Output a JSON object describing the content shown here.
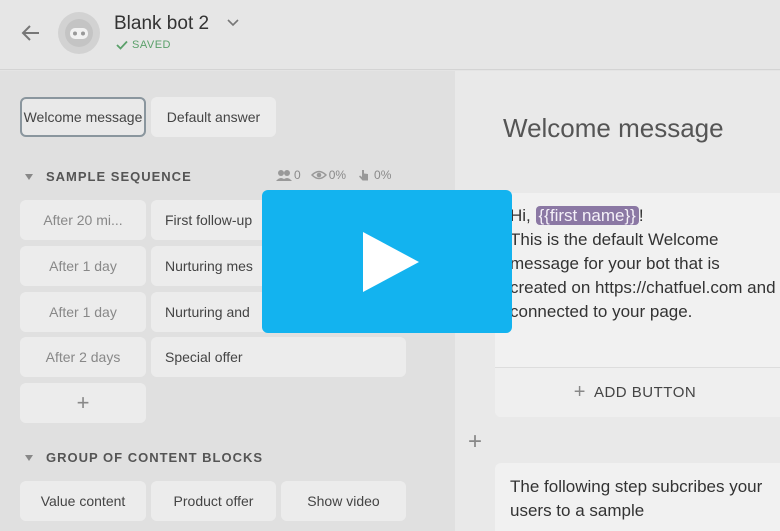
{
  "header": {
    "bot_name": "Blank bot 2",
    "saved_label": "SAVED"
  },
  "left": {
    "top_chips": [
      "Welcome message",
      "Default answer"
    ],
    "sequence": {
      "title": "SAMPLE SEQUENCE",
      "stats": {
        "users": "0",
        "views": "0%",
        "clicks": "0%"
      },
      "rows": [
        {
          "period": "After 20 mi...",
          "title": "First follow-up"
        },
        {
          "period": "After 1 day",
          "title": "Nurturing mes"
        },
        {
          "period": "After 1 day",
          "title": "Nurturing and"
        },
        {
          "period": "After 2 days",
          "title": "Special offer"
        }
      ],
      "add_label": "+"
    },
    "group": {
      "title": "GROUP OF CONTENT BLOCKS",
      "chips": [
        "Value content",
        "Product offer",
        "Show video"
      ]
    }
  },
  "right": {
    "block_title": "Welcome message",
    "card1": {
      "greeting_prefix": "Hi, ",
      "tag": "{{first name}}",
      "greeting_suffix": "!",
      "body": "This is the default Welcome message for your bot that is created on https://chatfuel.com and connected to your page."
    },
    "add_button_label": "ADD BUTTON",
    "side_plus": "+",
    "card2_text": "The following step subcribes your users to a sample"
  },
  "colors": {
    "play_button": "#13b3ef",
    "saved_green": "#5aa06a",
    "tag_purple": "#8b78a4"
  },
  "icons": [
    "back-arrow-icon",
    "bot-avatar-icon",
    "chevron-down-icon",
    "check-icon",
    "users-icon",
    "eye-icon",
    "hand-click-icon",
    "play-icon"
  ]
}
